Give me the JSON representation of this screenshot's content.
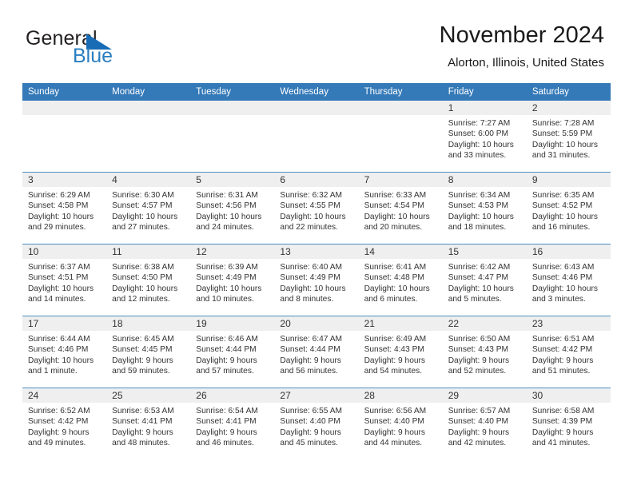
{
  "logo": {
    "word_top": "General",
    "word_bottom": "Blue",
    "triangle_color": "#176cb5",
    "blue_color": "#2a7ec0"
  },
  "header": {
    "title": "November 2024",
    "subtitle": "Alorton, Illinois, United States"
  },
  "theme": {
    "header_bg": "#3479b8",
    "header_text": "#ffffff",
    "daynum_band": "#efefef",
    "row_divider": "#4f8fc0"
  },
  "weekday_headers": [
    "Sunday",
    "Monday",
    "Tuesday",
    "Wednesday",
    "Thursday",
    "Friday",
    "Saturday"
  ],
  "labels": {
    "sunrise": "Sunrise:",
    "sunset": "Sunset:",
    "daylight": "Daylight:"
  },
  "weeks": [
    [
      {
        "day": "",
        "sunrise": "",
        "sunset": "",
        "daylight_line1": "",
        "daylight_line2": ""
      },
      {
        "day": "",
        "sunrise": "",
        "sunset": "",
        "daylight_line1": "",
        "daylight_line2": ""
      },
      {
        "day": "",
        "sunrise": "",
        "sunset": "",
        "daylight_line1": "",
        "daylight_line2": ""
      },
      {
        "day": "",
        "sunrise": "",
        "sunset": "",
        "daylight_line1": "",
        "daylight_line2": ""
      },
      {
        "day": "",
        "sunrise": "",
        "sunset": "",
        "daylight_line1": "",
        "daylight_line2": ""
      },
      {
        "day": "1",
        "sunrise": "Sunrise: 7:27 AM",
        "sunset": "Sunset: 6:00 PM",
        "daylight_line1": "Daylight: 10 hours",
        "daylight_line2": "and 33 minutes."
      },
      {
        "day": "2",
        "sunrise": "Sunrise: 7:28 AM",
        "sunset": "Sunset: 5:59 PM",
        "daylight_line1": "Daylight: 10 hours",
        "daylight_line2": "and 31 minutes."
      }
    ],
    [
      {
        "day": "3",
        "sunrise": "Sunrise: 6:29 AM",
        "sunset": "Sunset: 4:58 PM",
        "daylight_line1": "Daylight: 10 hours",
        "daylight_line2": "and 29 minutes."
      },
      {
        "day": "4",
        "sunrise": "Sunrise: 6:30 AM",
        "sunset": "Sunset: 4:57 PM",
        "daylight_line1": "Daylight: 10 hours",
        "daylight_line2": "and 27 minutes."
      },
      {
        "day": "5",
        "sunrise": "Sunrise: 6:31 AM",
        "sunset": "Sunset: 4:56 PM",
        "daylight_line1": "Daylight: 10 hours",
        "daylight_line2": "and 24 minutes."
      },
      {
        "day": "6",
        "sunrise": "Sunrise: 6:32 AM",
        "sunset": "Sunset: 4:55 PM",
        "daylight_line1": "Daylight: 10 hours",
        "daylight_line2": "and 22 minutes."
      },
      {
        "day": "7",
        "sunrise": "Sunrise: 6:33 AM",
        "sunset": "Sunset: 4:54 PM",
        "daylight_line1": "Daylight: 10 hours",
        "daylight_line2": "and 20 minutes."
      },
      {
        "day": "8",
        "sunrise": "Sunrise: 6:34 AM",
        "sunset": "Sunset: 4:53 PM",
        "daylight_line1": "Daylight: 10 hours",
        "daylight_line2": "and 18 minutes."
      },
      {
        "day": "9",
        "sunrise": "Sunrise: 6:35 AM",
        "sunset": "Sunset: 4:52 PM",
        "daylight_line1": "Daylight: 10 hours",
        "daylight_line2": "and 16 minutes."
      }
    ],
    [
      {
        "day": "10",
        "sunrise": "Sunrise: 6:37 AM",
        "sunset": "Sunset: 4:51 PM",
        "daylight_line1": "Daylight: 10 hours",
        "daylight_line2": "and 14 minutes."
      },
      {
        "day": "11",
        "sunrise": "Sunrise: 6:38 AM",
        "sunset": "Sunset: 4:50 PM",
        "daylight_line1": "Daylight: 10 hours",
        "daylight_line2": "and 12 minutes."
      },
      {
        "day": "12",
        "sunrise": "Sunrise: 6:39 AM",
        "sunset": "Sunset: 4:49 PM",
        "daylight_line1": "Daylight: 10 hours",
        "daylight_line2": "and 10 minutes."
      },
      {
        "day": "13",
        "sunrise": "Sunrise: 6:40 AM",
        "sunset": "Sunset: 4:49 PM",
        "daylight_line1": "Daylight: 10 hours",
        "daylight_line2": "and 8 minutes."
      },
      {
        "day": "14",
        "sunrise": "Sunrise: 6:41 AM",
        "sunset": "Sunset: 4:48 PM",
        "daylight_line1": "Daylight: 10 hours",
        "daylight_line2": "and 6 minutes."
      },
      {
        "day": "15",
        "sunrise": "Sunrise: 6:42 AM",
        "sunset": "Sunset: 4:47 PM",
        "daylight_line1": "Daylight: 10 hours",
        "daylight_line2": "and 5 minutes."
      },
      {
        "day": "16",
        "sunrise": "Sunrise: 6:43 AM",
        "sunset": "Sunset: 4:46 PM",
        "daylight_line1": "Daylight: 10 hours",
        "daylight_line2": "and 3 minutes."
      }
    ],
    [
      {
        "day": "17",
        "sunrise": "Sunrise: 6:44 AM",
        "sunset": "Sunset: 4:46 PM",
        "daylight_line1": "Daylight: 10 hours",
        "daylight_line2": "and 1 minute."
      },
      {
        "day": "18",
        "sunrise": "Sunrise: 6:45 AM",
        "sunset": "Sunset: 4:45 PM",
        "daylight_line1": "Daylight: 9 hours",
        "daylight_line2": "and 59 minutes."
      },
      {
        "day": "19",
        "sunrise": "Sunrise: 6:46 AM",
        "sunset": "Sunset: 4:44 PM",
        "daylight_line1": "Daylight: 9 hours",
        "daylight_line2": "and 57 minutes."
      },
      {
        "day": "20",
        "sunrise": "Sunrise: 6:47 AM",
        "sunset": "Sunset: 4:44 PM",
        "daylight_line1": "Daylight: 9 hours",
        "daylight_line2": "and 56 minutes."
      },
      {
        "day": "21",
        "sunrise": "Sunrise: 6:49 AM",
        "sunset": "Sunset: 4:43 PM",
        "daylight_line1": "Daylight: 9 hours",
        "daylight_line2": "and 54 minutes."
      },
      {
        "day": "22",
        "sunrise": "Sunrise: 6:50 AM",
        "sunset": "Sunset: 4:43 PM",
        "daylight_line1": "Daylight: 9 hours",
        "daylight_line2": "and 52 minutes."
      },
      {
        "day": "23",
        "sunrise": "Sunrise: 6:51 AM",
        "sunset": "Sunset: 4:42 PM",
        "daylight_line1": "Daylight: 9 hours",
        "daylight_line2": "and 51 minutes."
      }
    ],
    [
      {
        "day": "24",
        "sunrise": "Sunrise: 6:52 AM",
        "sunset": "Sunset: 4:42 PM",
        "daylight_line1": "Daylight: 9 hours",
        "daylight_line2": "and 49 minutes."
      },
      {
        "day": "25",
        "sunrise": "Sunrise: 6:53 AM",
        "sunset": "Sunset: 4:41 PM",
        "daylight_line1": "Daylight: 9 hours",
        "daylight_line2": "and 48 minutes."
      },
      {
        "day": "26",
        "sunrise": "Sunrise: 6:54 AM",
        "sunset": "Sunset: 4:41 PM",
        "daylight_line1": "Daylight: 9 hours",
        "daylight_line2": "and 46 minutes."
      },
      {
        "day": "27",
        "sunrise": "Sunrise: 6:55 AM",
        "sunset": "Sunset: 4:40 PM",
        "daylight_line1": "Daylight: 9 hours",
        "daylight_line2": "and 45 minutes."
      },
      {
        "day": "28",
        "sunrise": "Sunrise: 6:56 AM",
        "sunset": "Sunset: 4:40 PM",
        "daylight_line1": "Daylight: 9 hours",
        "daylight_line2": "and 44 minutes."
      },
      {
        "day": "29",
        "sunrise": "Sunrise: 6:57 AM",
        "sunset": "Sunset: 4:40 PM",
        "daylight_line1": "Daylight: 9 hours",
        "daylight_line2": "and 42 minutes."
      },
      {
        "day": "30",
        "sunrise": "Sunrise: 6:58 AM",
        "sunset": "Sunset: 4:39 PM",
        "daylight_line1": "Daylight: 9 hours",
        "daylight_line2": "and 41 minutes."
      }
    ]
  ]
}
